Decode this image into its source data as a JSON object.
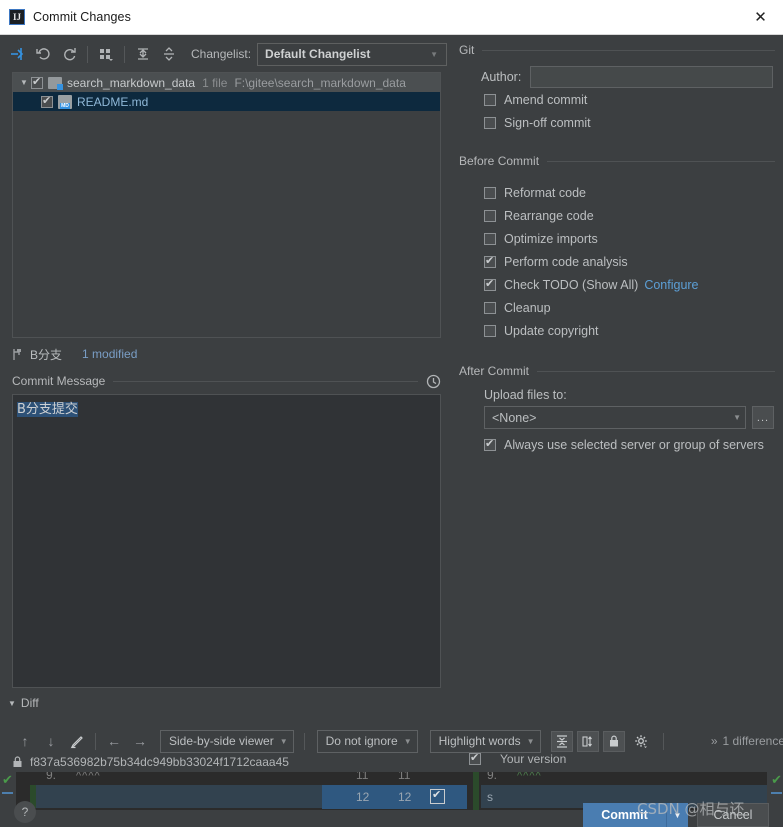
{
  "window": {
    "title": "Commit Changes",
    "app_icon": "intellij-idea-icon",
    "close_label": "✕"
  },
  "toolbar": {
    "buttons": [
      {
        "name": "show-diff-icon",
        "glyph": "↦"
      },
      {
        "name": "revert-icon",
        "glyph": "↺"
      },
      {
        "name": "refresh-icon",
        "glyph": "⟳"
      },
      {
        "name": "group-by-icon",
        "glyph": "▦"
      },
      {
        "name": "expand-all-icon",
        "glyph": "⤒"
      },
      {
        "name": "collapse-all-icon",
        "glyph": "⤓"
      }
    ],
    "changelist_label": "Changelist:",
    "changelist_value": "Default Changelist"
  },
  "file_tree": {
    "group": {
      "name": "search_markdown_data",
      "file_count": "1 file",
      "path": "F:\\gitee\\search_markdown_data",
      "checked": true,
      "expanded": true
    },
    "files": [
      {
        "name": "README.md",
        "checked": true,
        "selected": true,
        "icon": "markdown-file-icon"
      }
    ]
  },
  "status_bar": {
    "branch_icon": "branch-icon",
    "branch": "B分支",
    "modified": "1 modified"
  },
  "commit_message": {
    "label": "Commit Message",
    "history_icon": "clock-icon",
    "value": "B分支提交",
    "selected": true
  },
  "git_group": {
    "title": "Git",
    "author_label": "Author:",
    "author_value": "",
    "checkboxes": [
      {
        "label": "Amend commit",
        "checked": false,
        "mnemonic": "m"
      },
      {
        "label": "Sign-off commit",
        "checked": false,
        "mnemonic": "g"
      }
    ]
  },
  "before_commit_group": {
    "title": "Before Commit",
    "checkboxes": [
      {
        "label": "Reformat code",
        "checked": false
      },
      {
        "label": "Rearrange code",
        "checked": false
      },
      {
        "label": "Optimize imports",
        "checked": false
      },
      {
        "label": "Perform code analysis",
        "checked": true
      },
      {
        "label": "Check TODO (Show All)",
        "checked": true,
        "link": "Configure"
      },
      {
        "label": "Cleanup",
        "checked": false
      },
      {
        "label": "Update copyright",
        "checked": false
      }
    ]
  },
  "after_commit_group": {
    "title": "After Commit",
    "upload_label": "Upload files to:",
    "upload_value": "<None>",
    "browse_label": "...",
    "always_use_label": "Always use selected server or group of servers",
    "always_use_checked": true
  },
  "diff_section": {
    "title": "Diff",
    "nav_buttons": [
      {
        "name": "previous-difference-icon",
        "glyph": "↑"
      },
      {
        "name": "next-difference-icon",
        "glyph": "↓"
      },
      {
        "name": "edit-source-icon",
        "glyph": "✎"
      },
      {
        "name": "accept-left-icon",
        "glyph": "←"
      },
      {
        "name": "accept-right-icon",
        "glyph": "→"
      }
    ],
    "viewer_mode": "Side-by-side viewer",
    "ignore_mode": "Do not ignore",
    "highlight_mode": "Highlight words",
    "toggle_buttons": [
      {
        "name": "collapse-unchanged-icon",
        "glyph": "⤓"
      },
      {
        "name": "synchronize-scroll-icon",
        "glyph": "◫"
      },
      {
        "name": "read-only-lock-icon",
        "glyph": "🔒"
      },
      {
        "name": "diff-settings-gear-icon",
        "glyph": "⚙"
      }
    ],
    "expand_chevron": "»",
    "difference_count": "1 difference",
    "lock_icon": "lock-icon",
    "revision_hash": "f837a536982b75b34dc949bb33024f1712caaa45",
    "your_version_label": "Your version",
    "your_version_checked": true,
    "left_line_no": "",
    "change_line_left": "12",
    "change_line_right": "12",
    "change_accepted": true
  },
  "bottom": {
    "help_label": "?",
    "commit_label": "Commit",
    "commit_arrow": "▼",
    "cancel_label": "Cancel"
  },
  "watermark": "CSDN @相与还"
}
